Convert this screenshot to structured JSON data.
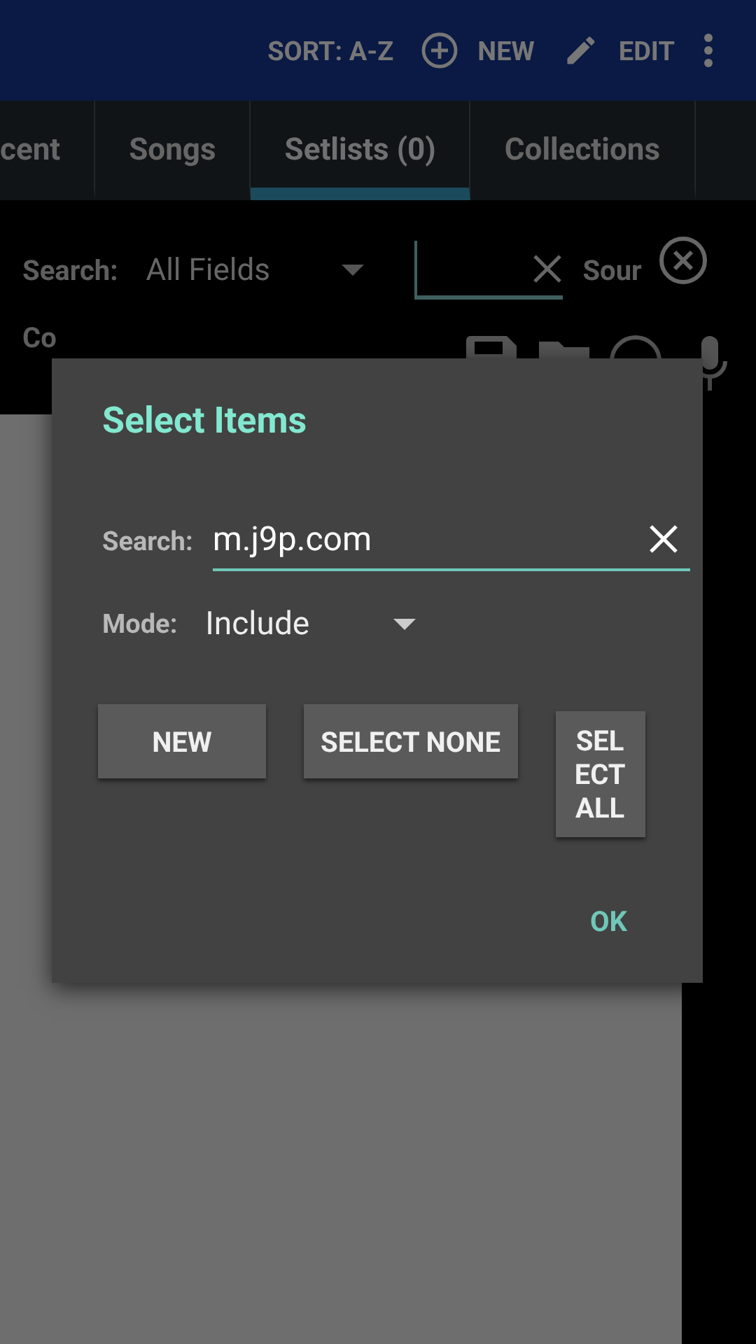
{
  "app_bar": {
    "actions": [
      {
        "kind": "text",
        "label": "SORT: A-Z"
      },
      {
        "kind": "add",
        "label": "NEW"
      },
      {
        "kind": "edit",
        "label": "EDIT"
      },
      {
        "kind": "more"
      }
    ]
  },
  "tabs": [
    {
      "label": "cent",
      "selected": false
    },
    {
      "label": "Songs",
      "selected": false
    },
    {
      "label": "Setlists (0)",
      "selected": true
    },
    {
      "label": "Collections",
      "selected": false
    }
  ],
  "filter_bar": {
    "search_label": "Search:",
    "field_choice": "All Fields",
    "source_label": "Sour"
  },
  "toolbar": {
    "label": "Co"
  },
  "dialog": {
    "title": "Select Items",
    "search_label": "Search:",
    "search_value": "m.j9p.com",
    "mode_label": "Mode:",
    "mode_value": "Include",
    "buttons": [
      "NEW",
      "SELECT NONE",
      "SELECT ALL"
    ],
    "ok": "OK"
  }
}
